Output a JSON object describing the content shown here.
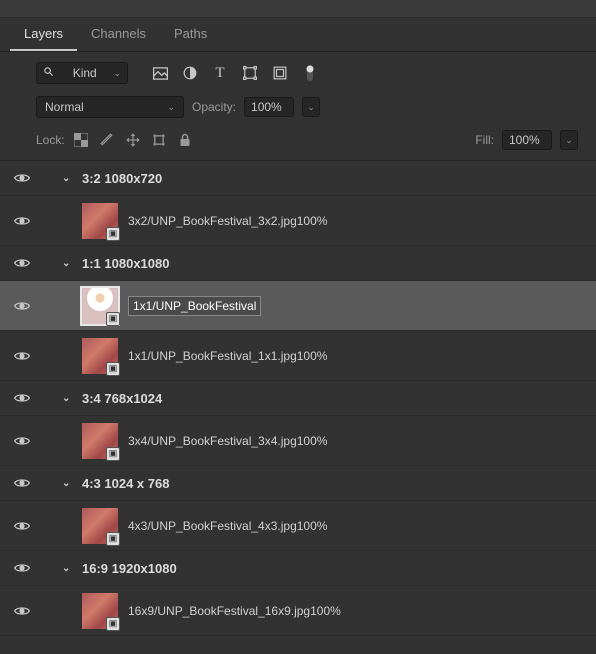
{
  "tabs": {
    "layers": "Layers",
    "channels": "Channels",
    "paths": "Paths"
  },
  "filter": {
    "label": "Kind"
  },
  "blend": {
    "mode": "Normal",
    "opacity_label": "Opacity:",
    "opacity_value": "100%"
  },
  "lock": {
    "label": "Lock:",
    "fill_label": "Fill:",
    "fill_value": "100%"
  },
  "groups": [
    {
      "name": "3:2 1080x720",
      "layers": [
        {
          "name": "3x2/UNP_BookFestival_3x2.jpg100%",
          "thumb": "pink"
        }
      ]
    },
    {
      "name": "1:1 1080x1080",
      "layers": [
        {
          "name": "1x1/UNP_BookFestival",
          "thumb": "person",
          "selected": true,
          "editing": true
        },
        {
          "name": "1x1/UNP_BookFestival_1x1.jpg100%",
          "thumb": "pink"
        }
      ]
    },
    {
      "name": "3:4 768x1024",
      "layers": [
        {
          "name": "3x4/UNP_BookFestival_3x4.jpg100%",
          "thumb": "pink"
        }
      ]
    },
    {
      "name": "4:3 1024 x 768",
      "layers": [
        {
          "name": "4x3/UNP_BookFestival_4x3.jpg100%",
          "thumb": "pink"
        }
      ]
    },
    {
      "name": "16:9 1920x1080",
      "layers": [
        {
          "name": "16x9/UNP_BookFestival_16x9.jpg100%",
          "thumb": "pink"
        }
      ]
    }
  ]
}
